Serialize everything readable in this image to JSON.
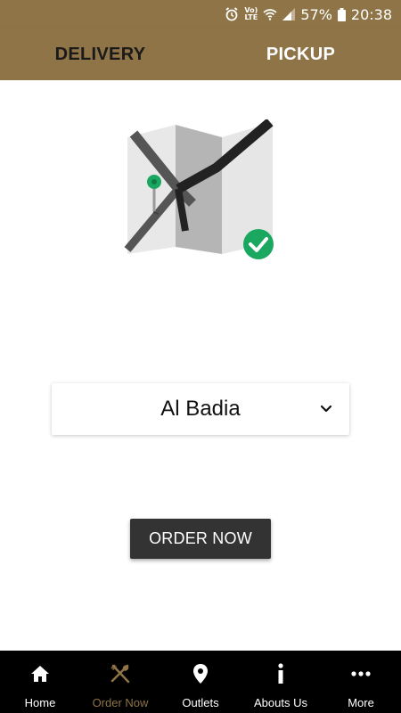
{
  "status_bar": {
    "battery": "57%",
    "time": "20:38",
    "network": "LTE",
    "volte": "Vo)",
    "icons": [
      "alarm-icon",
      "volte-lte-icon",
      "wifi-icon",
      "signal-icon",
      "battery-icon"
    ]
  },
  "tabs": [
    {
      "label": "DELIVERY",
      "selected": true
    },
    {
      "label": "PICKUP",
      "selected": false
    }
  ],
  "outlet": {
    "selected": "Al Badia"
  },
  "order_button": {
    "label": "ORDER NOW"
  },
  "bottom_nav": {
    "items": [
      {
        "label": "Home",
        "icon": "home-icon",
        "active": false
      },
      {
        "label": "Order Now",
        "icon": "fork-knife-icon",
        "active": true
      },
      {
        "label": "Outlets",
        "icon": "location-pin-icon",
        "active": false
      },
      {
        "label": "Abouts Us",
        "icon": "info-icon",
        "active": false
      },
      {
        "label": "More",
        "icon": "more-dots-icon",
        "active": false
      }
    ]
  },
  "colors": {
    "brand": "#8e7446",
    "button": "#333333",
    "nav_background": "#000000",
    "check_badge": "#1aa760"
  }
}
